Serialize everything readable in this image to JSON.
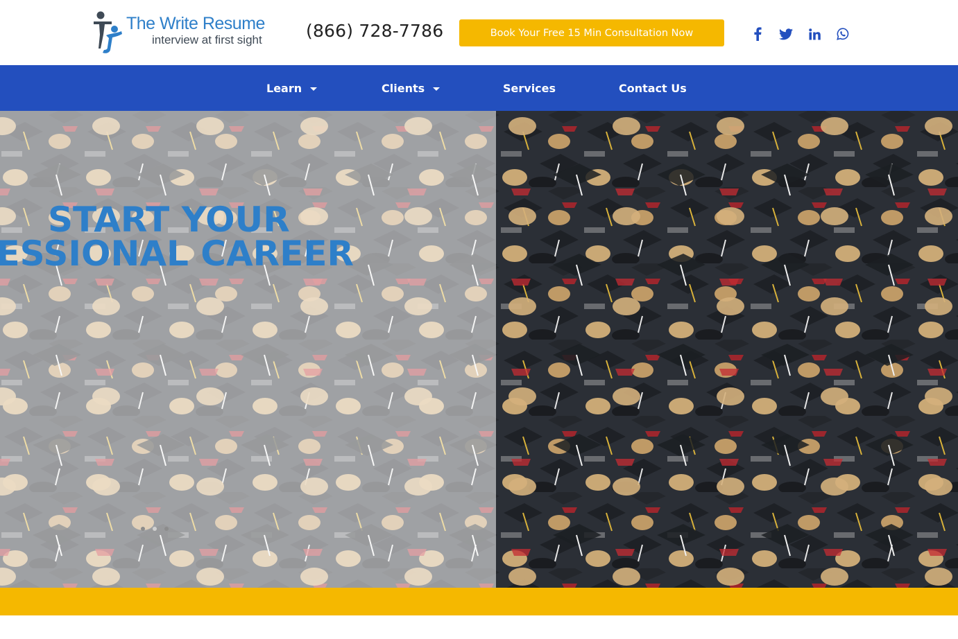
{
  "header": {
    "logo_title": "The Write Resume",
    "logo_tagline": "interview at first sight",
    "phone": "(866) 728-7786",
    "cta_label": "Book Your Free 15 Min Consultation Now",
    "social": [
      {
        "name": "facebook-icon"
      },
      {
        "name": "twitter-icon"
      },
      {
        "name": "linkedin-icon"
      },
      {
        "name": "whatsapp-icon"
      }
    ]
  },
  "nav": {
    "items": [
      {
        "label": "Learn",
        "has_dropdown": true
      },
      {
        "label": "Clients",
        "has_dropdown": true
      },
      {
        "label": "Services",
        "has_dropdown": false
      },
      {
        "label": "Contact Us",
        "has_dropdown": false
      }
    ]
  },
  "hero": {
    "title_line1": "START YOUR",
    "title_line2": "PROFESSIONAL CAREER",
    "slides_count": 3,
    "active_slide": 2
  },
  "colors": {
    "brand_blue": "#2e7fc9",
    "nav_blue": "#234fbe",
    "accent_yellow": "#f5b800",
    "social_blue": "#234fbe"
  }
}
